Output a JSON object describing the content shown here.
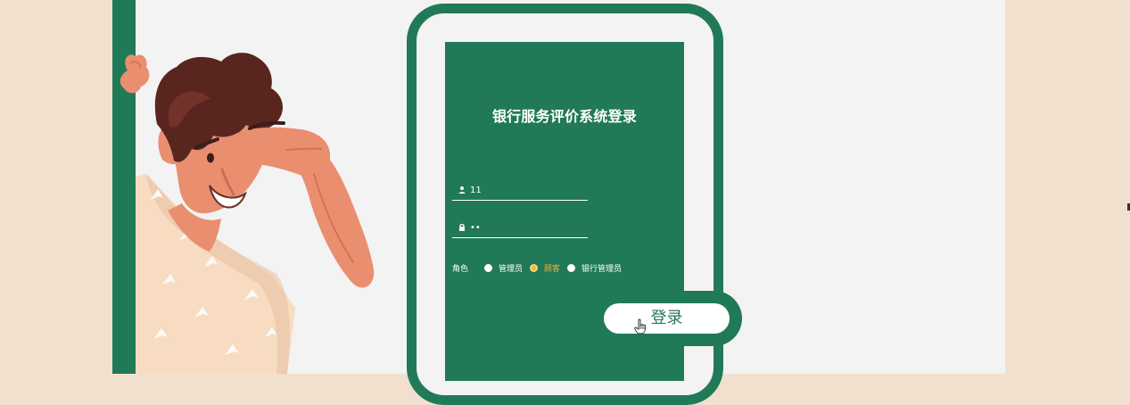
{
  "login": {
    "title": "银行服务评价系统登录",
    "username_value": "11",
    "password_value": "••",
    "role_label": "角色",
    "roles": [
      {
        "label": "管理员",
        "selected": false
      },
      {
        "label": "顾客",
        "selected": true
      },
      {
        "label": "银行管理员",
        "selected": false
      }
    ],
    "login_button": "登录"
  },
  "colors": {
    "brand_green": "#217a57",
    "page_background": "#f2e0cf",
    "stage_background": "#f3f3f3",
    "selected_radio": "#f0b43a"
  },
  "icons": {
    "username": "user-icon",
    "password": "lock-icon",
    "cursor": "hand-cursor-icon"
  }
}
